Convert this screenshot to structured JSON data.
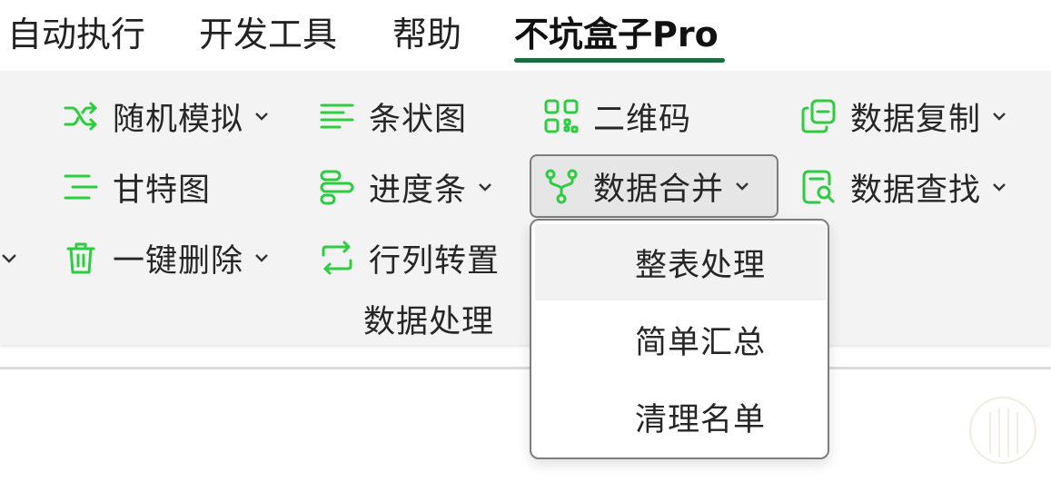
{
  "tabs": [
    {
      "label": "自动执行"
    },
    {
      "label": "开发工具"
    },
    {
      "label": "帮助"
    },
    {
      "label": "不坑盒子Pro",
      "active": true
    }
  ],
  "ribbon": {
    "group_label": "数据处理",
    "buttons": {
      "random": {
        "label": "随机模拟",
        "icon": "shuffle-icon",
        "has_dropdown": true
      },
      "gantt": {
        "label": "甘特图",
        "icon": "gantt-icon",
        "has_dropdown": false
      },
      "delete": {
        "label": "一键删除",
        "icon": "trash-icon",
        "has_dropdown": true
      },
      "barchart": {
        "label": "条状图",
        "icon": "bar-lines-icon",
        "has_dropdown": false
      },
      "progress": {
        "label": "进度条",
        "icon": "progress-icon",
        "has_dropdown": true
      },
      "transpose": {
        "label": "行列转置",
        "icon": "transpose-icon",
        "has_dropdown": false
      },
      "qrcode": {
        "label": "二维码",
        "icon": "qrcode-icon",
        "has_dropdown": false
      },
      "merge": {
        "label": "数据合并",
        "icon": "merge-icon",
        "has_dropdown": true,
        "pressed": true
      },
      "copy": {
        "label": "数据复制",
        "icon": "copy-icon",
        "has_dropdown": true
      },
      "find": {
        "label": "数据查找",
        "icon": "find-icon",
        "has_dropdown": true
      }
    }
  },
  "merge_menu": {
    "items": [
      {
        "label": "整表处理",
        "hover": true
      },
      {
        "label": "简单汇总"
      },
      {
        "label": "清理名单"
      }
    ]
  },
  "colors": {
    "accent_green": "#2ecc40",
    "tab_underline": "#1e6b40",
    "ribbon_bg": "#f3f3f3"
  }
}
